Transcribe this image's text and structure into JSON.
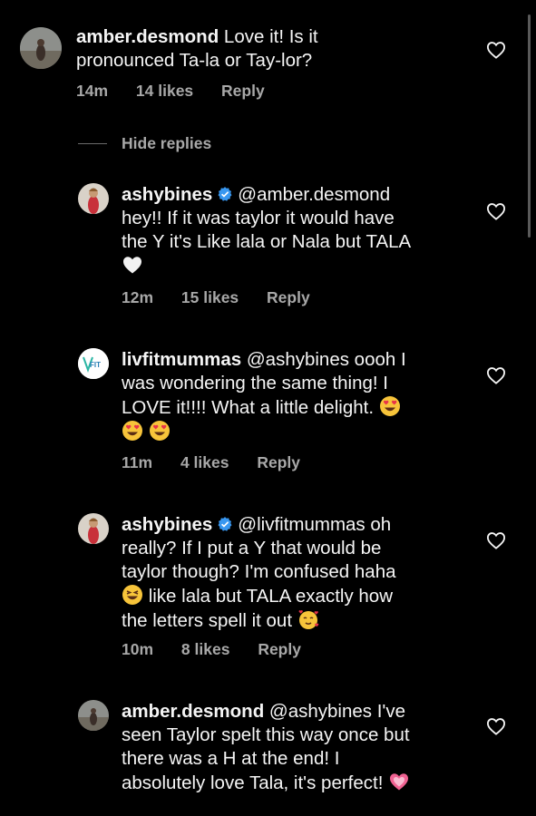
{
  "hide_replies_label": "Hide replies",
  "verified_icon_color": "#3897f0",
  "comments": [
    {
      "username": "amber.desmond",
      "line1": "Love it! Is it",
      "line2": "pronounced Ta-la or Tay-lor?",
      "time": "14m",
      "likes": "14 likes",
      "reply": "Reply"
    },
    {
      "username": "ashybines",
      "verified": true,
      "line1": "@amber.desmond",
      "line2": "hey!! If it was taylor it would have",
      "line3": "the Y it's Like lala or Nala but TALA",
      "emoji": "white-heart",
      "time": "12m",
      "likes": "15 likes",
      "reply": "Reply"
    },
    {
      "username": "livfitmummas",
      "avatar_text": "FIT",
      "line1": "@ashybines oooh I",
      "line2": "was wondering the same thing! I",
      "line3": "LOVE it!!!! What a little delight.",
      "emoji": "heart-eyes x3",
      "time": "11m",
      "likes": "4 likes",
      "reply": "Reply"
    },
    {
      "username": "ashybines",
      "verified": true,
      "line1": "@livfitmummas oh",
      "line2": "really? If I put a Y that would be",
      "line3": "taylor though? I'm confused haha",
      "line4": "like lala but TALA exactly how",
      "line5": "the letters spell it out",
      "time": "10m",
      "likes": "8 likes",
      "reply": "Reply"
    },
    {
      "username": "amber.desmond",
      "line1": "@ashybines I've",
      "line2": "seen Taylor spelt this way once but",
      "line3": "there was a H at the end! I",
      "line4": "absolutely love Tala, it's perfect!",
      "emoji": "growing-heart"
    }
  ]
}
